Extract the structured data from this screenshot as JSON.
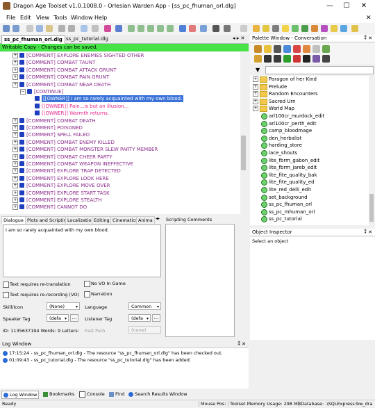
{
  "window": {
    "title": "Dragon Age Toolset v1.0.1008.0 - Orlesian Warden App - [ss_pc_fhuman_orl.dlg]",
    "minimize": "—",
    "maximize": "☐",
    "close": "✕"
  },
  "menu": [
    "File",
    "Edit",
    "View",
    "Tools",
    "Window",
    "Help"
  ],
  "doc_tabs": [
    "ss_pc_fhuman_orl.dlg",
    "ss_pc_tutorial.dlg"
  ],
  "banner": "Writable Copy - Changes can be saved.",
  "tree_rows": [
    {
      "text": "[COMMENT] EXPLORE ENEMIES SIGHTED OTHER",
      "indent": 0,
      "color": "#8b2c8b",
      "sq": "#1f3fbf",
      "hl": false
    },
    {
      "text": "[COMMENT] COMBAT TAUNT",
      "indent": 0,
      "color": "#8b2c8b",
      "sq": "#1f3fbf",
      "hl": false
    },
    {
      "text": "[COMMENT] COMBAT ATTACK GRUNT",
      "indent": 0,
      "color": "#8b2c8b",
      "sq": "#1f3fbf",
      "hl": false
    },
    {
      "text": "[COMMENT] COMBAT PAIN GRUNT",
      "indent": 0,
      "color": "#8b2c8b",
      "sq": "#1f3fbf",
      "hl": false
    },
    {
      "text": "[COMMENT] COMBAT NEAR DEATH",
      "indent": 0,
      "color": "#8b2c8b",
      "sq": "#1f3fbf",
      "hl": false
    },
    {
      "text": "[CONTINUE]",
      "indent": 1,
      "color": "#8b2c8b",
      "sq": "#1f3fbf",
      "hl": false
    },
    {
      "text": "[[OWNER]] I am so rarely acquainted with my own blood.",
      "indent": 2,
      "color": "#ffffff",
      "sq": "#1f3fbf",
      "hl": true
    },
    {
      "text": "[[OWNER]] Pain...is but an illusion...",
      "indent": 2,
      "color": "#e0248a",
      "sq": "#1f3fbf",
      "hl": false
    },
    {
      "text": "[[OWNER]] Warmth returns.",
      "indent": 2,
      "color": "#e0248a",
      "sq": "#1f3fbf",
      "hl": false
    },
    {
      "text": "[COMMENT] COMBAT DEATH",
      "indent": 0,
      "color": "#8b2c8b",
      "sq": "#1f3fbf",
      "hl": false
    },
    {
      "text": "[COMMENT] POISONED",
      "indent": 0,
      "color": "#8b2c8b",
      "sq": "#1f3fbf",
      "hl": false
    },
    {
      "text": "[COMMENT] SPELL FAILED",
      "indent": 0,
      "color": "#8b2c8b",
      "sq": "#1f3fbf",
      "hl": false
    },
    {
      "text": "[COMMENT] COMBAT ENEMY KILLED",
      "indent": 0,
      "color": "#8b2c8b",
      "sq": "#1f3fbf",
      "hl": false
    },
    {
      "text": "[COMMENT] COMBAT MONSTER SLEW PARTY MEMBER",
      "indent": 0,
      "color": "#8b2c8b",
      "sq": "#1f3fbf",
      "hl": false
    },
    {
      "text": "[COMMENT] COMBAT CHEER PARTY",
      "indent": 0,
      "color": "#8b2c8b",
      "sq": "#1f3fbf",
      "hl": false
    },
    {
      "text": "[COMMENT] COMBAT WEAPON INEFFECTIVE",
      "indent": 0,
      "color": "#8b2c8b",
      "sq": "#1f3fbf",
      "hl": false
    },
    {
      "text": "[COMMENT] EXPLORE TRAP DETECTED",
      "indent": 0,
      "color": "#8b2c8b",
      "sq": "#1f3fbf",
      "hl": false
    },
    {
      "text": "[COMMENT] EXPLORE LOOK HERE",
      "indent": 0,
      "color": "#8b2c8b",
      "sq": "#1f3fbf",
      "hl": false
    },
    {
      "text": "[COMMENT] EXPLORE MOVE OVER",
      "indent": 0,
      "color": "#8b2c8b",
      "sq": "#1f3fbf",
      "hl": false
    },
    {
      "text": "[COMMENT] EXPLORE START TASK",
      "indent": 0,
      "color": "#8b2c8b",
      "sq": "#1f3fbf",
      "hl": false
    },
    {
      "text": "[COMMENT] EXPLORE STEALTH",
      "indent": 0,
      "color": "#8b2c8b",
      "sq": "#1f3fbf",
      "hl": false
    },
    {
      "text": "[COMMENT] CANNOT DO",
      "indent": 0,
      "color": "#8b2c8b",
      "sq": "#1f3fbf",
      "hl": false
    }
  ],
  "lower_tabs": [
    "Dialogue",
    "Plots and Scripting",
    "Localization",
    "Editing",
    "Cinematics",
    "Anima"
  ],
  "scripting_comments": "Scripting Comments",
  "dialogue_text": "I am so rarely acquainted with my own blood.",
  "checks": {
    "translation": "Text requires re-translation",
    "vo_in_game": "No VO In Game",
    "rerecording": "Text requires re-recording (VO)",
    "narration": "Narration"
  },
  "fields": {
    "skill_label": "Skill/Icon",
    "skill_value": "(None)",
    "language_label": "Language",
    "language_value": "Common",
    "speaker_label": "Speaker Tag",
    "speaker_value": "(defa",
    "listener_label": "Listener Tag",
    "listener_value": "(defa",
    "id_text": "ID: 1135637194  Words: 9  Letters:",
    "fastpath_label": "Fast Path",
    "fastpath_value": "(none)",
    "dots": "..."
  },
  "palette": {
    "title": "Palette Window - Conversation",
    "items": [
      {
        "text": "Paragon of her Kind",
        "kind": "folder"
      },
      {
        "text": "Prelude",
        "kind": "folder"
      },
      {
        "text": "Random Encounters",
        "kind": "folder"
      },
      {
        "text": "Sacred Urn",
        "kind": "folder"
      },
      {
        "text": "World Map",
        "kind": "folder"
      },
      {
        "text": "arl100cr_murdock_edit",
        "kind": "leaf"
      },
      {
        "text": "arl100cr_perth_edit",
        "kind": "leaf"
      },
      {
        "text": "camp_bloodmage",
        "kind": "leaf"
      },
      {
        "text": "den_herbalist",
        "kind": "leaf"
      },
      {
        "text": "harding_store",
        "kind": "leaf"
      },
      {
        "text": "lace_shouts",
        "kind": "leaf"
      },
      {
        "text": "lite_fbrm_gabon_edit",
        "kind": "leaf"
      },
      {
        "text": "lite_fbrm_jareb_edit",
        "kind": "leaf"
      },
      {
        "text": "lite_fite_quality_bak",
        "kind": "leaf"
      },
      {
        "text": "lite_fite_quality_ed",
        "kind": "leaf"
      },
      {
        "text": "lite_red_delli_edit",
        "kind": "leaf"
      },
      {
        "text": "set_background",
        "kind": "leaf"
      },
      {
        "text": "ss_pc_fhuman_orl",
        "kind": "leaf"
      },
      {
        "text": "ss_pc_mhuman_orl",
        "kind": "leaf"
      },
      {
        "text": "ss_pc_tutorial",
        "kind": "leaf"
      }
    ]
  },
  "inspector": {
    "title": "Object Inspector",
    "prompt": "Select an object"
  },
  "log": {
    "title": "Log Window",
    "lines": [
      "17:15:24 - ss_pc_fhuman_orl.dlg - The resource \"ss_pc_fhuman_orl.dlg\" has been checked out.",
      "01:09:43 - ss_pc_tutorial.dlg - The resource \"ss_pc_tutorial.dlg\" has been added."
    ]
  },
  "bottom_tabs": [
    "Log Window",
    "Bookmarks",
    "Console",
    "Find",
    "Search Results Window"
  ],
  "status": {
    "ready": "Ready",
    "mouse": "Mouse Pos:",
    "memory": "Toolset Memory Usage: 298 MB",
    "database": "Database: .\\SQLExpress:bw_dra"
  },
  "colors": {
    "banner": "#45e345",
    "selection": "#3b73d9",
    "comment": "#8b2c8b",
    "owner_line": "#e0248a"
  }
}
